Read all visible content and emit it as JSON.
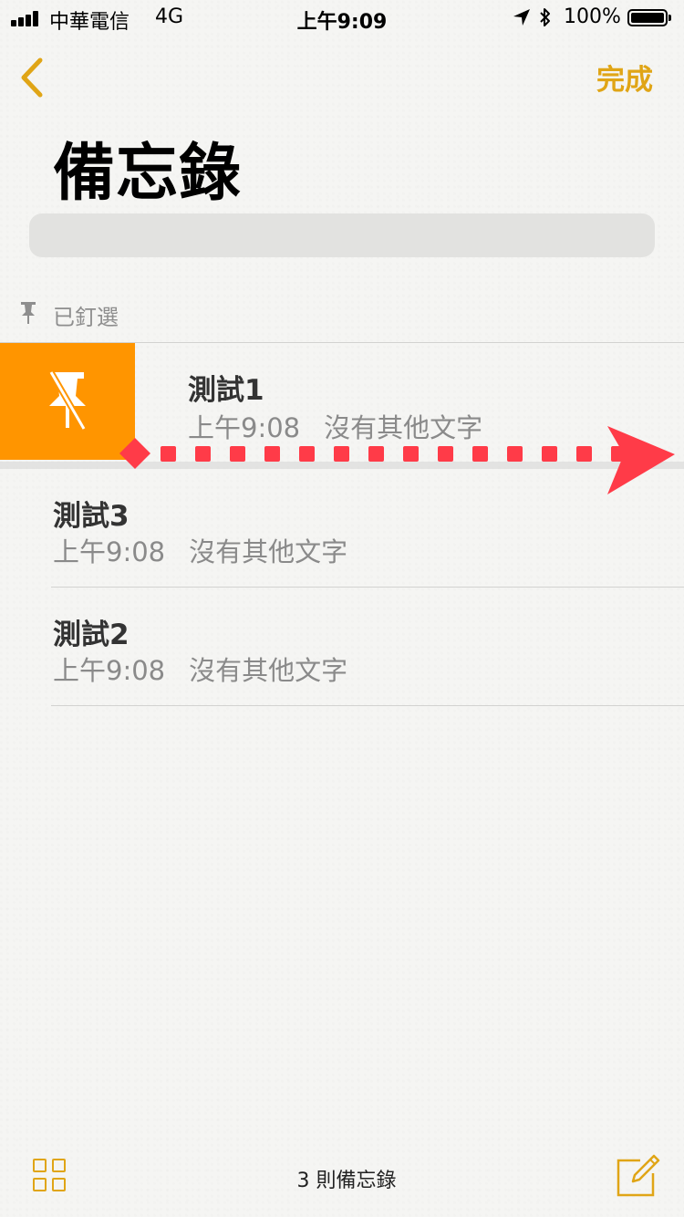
{
  "status_bar": {
    "carrier": "中華電信",
    "network": "4G",
    "time": "上午9:09",
    "battery": "100%"
  },
  "nav": {
    "done_label": "完成"
  },
  "page": {
    "title": "備忘錄"
  },
  "pinned_section": {
    "label": "已釘選"
  },
  "notes": [
    {
      "title": "測試1",
      "time": "上午9:08",
      "preview": "沒有其他文字",
      "pinned": true
    },
    {
      "title": "測試3",
      "time": "上午9:08",
      "preview": "沒有其他文字",
      "pinned": false
    },
    {
      "title": "測試2",
      "time": "上午9:08",
      "preview": "沒有其他文字",
      "pinned": false
    }
  ],
  "toolbar": {
    "count_label": "3 則備忘錄"
  },
  "colors": {
    "accent": "#e0a516",
    "swipe_action": "#ff9500",
    "annotation": "#ff3b48"
  },
  "icons": {
    "back": "chevron-left-icon",
    "pin": "pin-icon",
    "unpin": "unpin-icon",
    "folders": "grid-icon",
    "compose": "compose-icon"
  }
}
